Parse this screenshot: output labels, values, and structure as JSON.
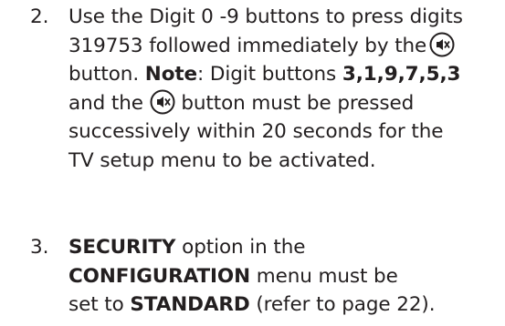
{
  "steps": [
    {
      "number": "2.",
      "lines": [
        {
          "parts": [
            "Use the Digit 0 -9 buttons to press digits"
          ]
        },
        {
          "parts": [
            "319753 followed immediately by the",
            "mute-icon"
          ]
        },
        {
          "parts": [
            "button. ",
            "Note",
            ": Digit buttons ",
            "3,1,9,7,5,3"
          ]
        },
        {
          "parts": [
            "and the ",
            "mute-icon",
            " button must be pressed"
          ]
        },
        {
          "parts": [
            "successively within 20 seconds for the"
          ]
        },
        {
          "parts": [
            "TV setup menu to be activated."
          ]
        }
      ]
    },
    {
      "number": "3.",
      "lines": [
        {
          "parts": [
            "SECURITY",
            " option in the"
          ]
        },
        {
          "parts": [
            "CONFIGURATION",
            " menu must be"
          ]
        },
        {
          "parts": [
            "set to ",
            "STANDARD",
            " (refer to page 22)."
          ]
        }
      ]
    }
  ]
}
